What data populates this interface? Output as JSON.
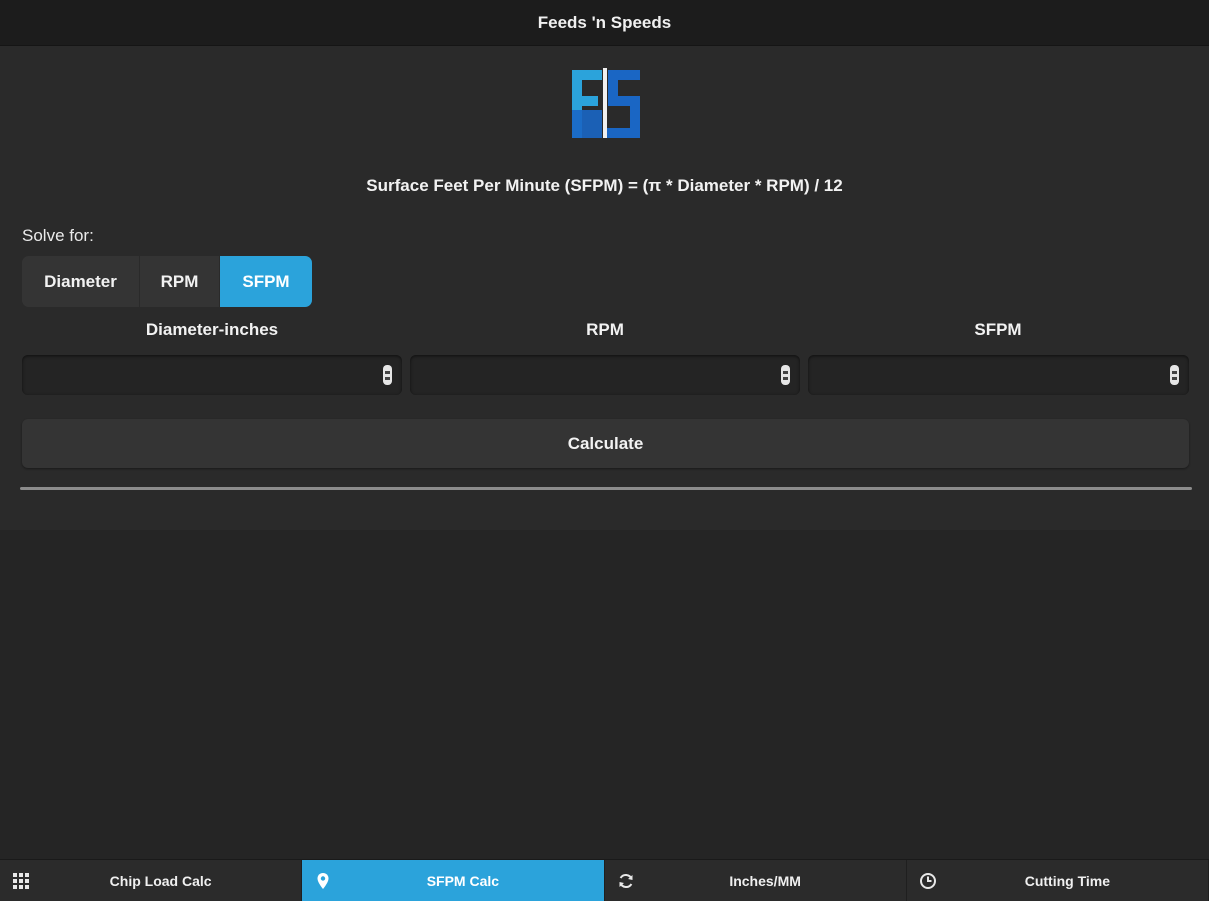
{
  "header": {
    "title": "Feeds 'n Speeds"
  },
  "logo": {
    "name": "fs-logo-icon",
    "colors": [
      "#2ba3db",
      "#1a66c4",
      "#ffffff"
    ]
  },
  "formula": "Surface Feet Per Minute (SFPM) = (π * Diameter * RPM) / 12",
  "solve_for": {
    "label": "Solve for:",
    "options": [
      "Diameter",
      "RPM",
      "SFPM"
    ],
    "selected": "SFPM"
  },
  "fields": [
    {
      "label": "Diameter-inches",
      "value": "",
      "placeholder": ""
    },
    {
      "label": "RPM",
      "value": "",
      "placeholder": ""
    },
    {
      "label": "SFPM",
      "value": "",
      "placeholder": ""
    }
  ],
  "calculate_label": "Calculate",
  "tabs": [
    {
      "label": "Chip Load Calc",
      "icon": "grid-icon",
      "active": false
    },
    {
      "label": "SFPM Calc",
      "icon": "location-pin-icon",
      "active": true
    },
    {
      "label": "Inches/MM",
      "icon": "refresh-icon",
      "active": false
    },
    {
      "label": "Cutting Time",
      "icon": "clock-icon",
      "active": false
    }
  ],
  "colors": {
    "accent": "#2ba3db",
    "background": "#252525",
    "header": "#1c1c1c"
  }
}
